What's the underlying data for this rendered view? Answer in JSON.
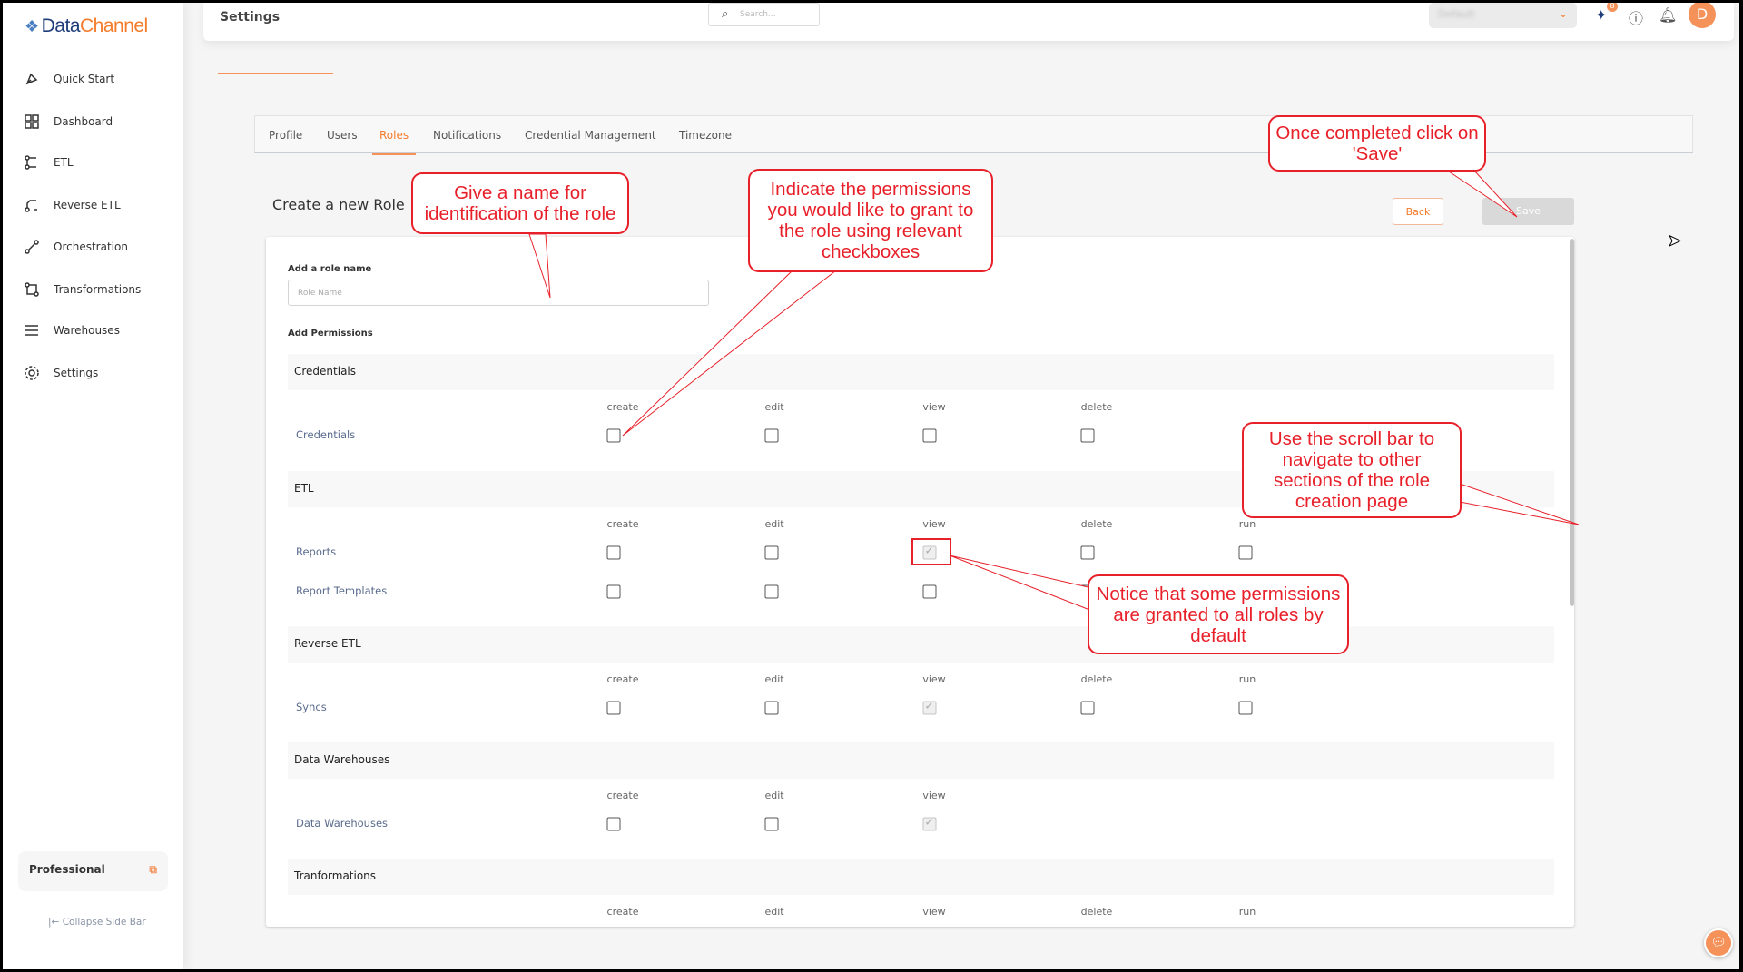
{
  "sidebar": {
    "logo": {
      "part1": "Data",
      "part2": "Channel"
    },
    "items": [
      {
        "label": "Quick Start",
        "icon": "rocket-icon"
      },
      {
        "label": "Dashboard",
        "icon": "dashboard-icon"
      },
      {
        "label": "ETL",
        "icon": "etl-icon"
      },
      {
        "label": "Reverse ETL",
        "icon": "reverse-etl-icon"
      },
      {
        "label": "Orchestration",
        "icon": "orchestration-icon"
      },
      {
        "label": "Transformations",
        "icon": "transformations-icon"
      },
      {
        "label": "Warehouses",
        "icon": "warehouses-icon"
      },
      {
        "label": "Settings",
        "icon": "gear-icon"
      }
    ],
    "plan": "Professional",
    "collapse": "Collapse Side Bar"
  },
  "header": {
    "title": "Settings",
    "search_placeholder": "Search...",
    "workspace": "Default",
    "notification_badge": "8",
    "avatar": "D"
  },
  "tabs": [
    {
      "label": "Profile"
    },
    {
      "label": "Users"
    },
    {
      "label": "Roles",
      "active": true
    },
    {
      "label": "Notifications"
    },
    {
      "label": "Credential Management"
    },
    {
      "label": "Timezone"
    }
  ],
  "page": {
    "title": "Create a new Role",
    "back": "Back",
    "save": "Save",
    "role_name_label": "Add a role name",
    "role_name_placeholder": "Role Name",
    "role_name_value": "",
    "permissions_label": "Add Permissions"
  },
  "sections": [
    {
      "title": "Credentials",
      "columns": [
        "create",
        "edit",
        "view",
        "delete"
      ],
      "rows": [
        {
          "label": "Credentials",
          "checked": [
            false,
            false,
            false,
            false
          ]
        }
      ]
    },
    {
      "title": "ETL",
      "columns": [
        "create",
        "edit",
        "view",
        "delete",
        "run"
      ],
      "rows": [
        {
          "label": "Reports",
          "checked": [
            false,
            false,
            true,
            false,
            false
          ]
        },
        {
          "label": "Report Templates",
          "checked": [
            false,
            false,
            false,
            false
          ]
        }
      ]
    },
    {
      "title": "Reverse ETL",
      "columns": [
        "create",
        "edit",
        "view",
        "delete",
        "run"
      ],
      "rows": [
        {
          "label": "Syncs",
          "checked": [
            false,
            false,
            true,
            false,
            false
          ]
        }
      ]
    },
    {
      "title": "Data Warehouses",
      "columns": [
        "create",
        "edit",
        "view"
      ],
      "rows": [
        {
          "label": "Data Warehouses",
          "checked": [
            false,
            false,
            true
          ]
        }
      ]
    },
    {
      "title": "Tranformations",
      "columns": [
        "create",
        "edit",
        "view",
        "delete",
        "run"
      ],
      "rows": []
    }
  ],
  "annotations": {
    "name": "Give a name for identification of the role",
    "permissions": "Indicate the permissions you would like to grant to the role using relevant checkboxes",
    "save": "Once completed click on 'Save'",
    "scroll": "Use the scroll bar to navigate to other sections of the role creation page",
    "defaults": "Notice that some permissions are granted to all roles by default"
  },
  "colors": {
    "accent": "#f47b2a",
    "annotation": "#e8202a"
  }
}
